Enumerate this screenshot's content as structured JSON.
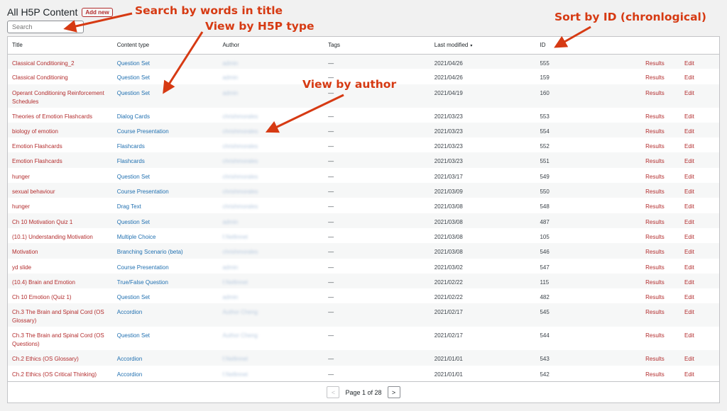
{
  "header": {
    "title": "All H5P Content",
    "add_new": "Add new"
  },
  "search": {
    "placeholder": "Search"
  },
  "columns": [
    "Title",
    "Content type",
    "Author",
    "Tags",
    "Last modified",
    "ID"
  ],
  "sort_indicator": "▾",
  "rows": [
    {
      "title": "Classical Conditioning_2",
      "type": "Question Set",
      "author": "admin",
      "tags": "—",
      "modified": "2021/04/26",
      "id": "555",
      "results": "Results",
      "edit": "Edit"
    },
    {
      "title": "Classical Conditioning",
      "type": "Question Set",
      "author": "admin",
      "tags": "—",
      "modified": "2021/04/26",
      "id": "159",
      "results": "Results",
      "edit": "Edit"
    },
    {
      "title": "Operant Conditioning Reinforcement Schedules",
      "type": "Question Set",
      "author": "admin",
      "tags": "—",
      "modified": "2021/04/19",
      "id": "160",
      "results": "Results",
      "edit": "Edit",
      "tall": true
    },
    {
      "title": "Theories of Emotion Flashcards",
      "type": "Dialog Cards",
      "author": "chrishmorales",
      "tags": "—",
      "modified": "2021/03/23",
      "id": "553",
      "results": "Results",
      "edit": "Edit"
    },
    {
      "title": "biology of emotion",
      "type": "Course Presentation",
      "author": "chrishmorales",
      "tags": "—",
      "modified": "2021/03/23",
      "id": "554",
      "results": "Results",
      "edit": "Edit"
    },
    {
      "title": "Emotion Flashcards",
      "type": "Flashcards",
      "author": "chrishmorales",
      "tags": "—",
      "modified": "2021/03/23",
      "id": "552",
      "results": "Results",
      "edit": "Edit"
    },
    {
      "title": "Emotion Flashcards",
      "type": "Flashcards",
      "author": "chrishmorales",
      "tags": "—",
      "modified": "2021/03/23",
      "id": "551",
      "results": "Results",
      "edit": "Edit"
    },
    {
      "title": "hunger",
      "type": "Question Set",
      "author": "chrishmorales",
      "tags": "—",
      "modified": "2021/03/17",
      "id": "549",
      "results": "Results",
      "edit": "Edit"
    },
    {
      "title": "sexual behaviour",
      "type": "Course Presentation",
      "author": "chrishmorales",
      "tags": "—",
      "modified": "2021/03/09",
      "id": "550",
      "results": "Results",
      "edit": "Edit"
    },
    {
      "title": "hunger",
      "type": "Drag Text",
      "author": "chrishmorales",
      "tags": "—",
      "modified": "2021/03/08",
      "id": "548",
      "results": "Results",
      "edit": "Edit"
    },
    {
      "title": "Ch 10 Motivation Quiz 1",
      "type": "Question Set",
      "author": "admin",
      "tags": "—",
      "modified": "2021/03/08",
      "id": "487",
      "results": "Results",
      "edit": "Edit"
    },
    {
      "title": "(10.1) Understanding Motivation",
      "type": "Multiple Choice",
      "author": "f.Nellinnet",
      "tags": "—",
      "modified": "2021/03/08",
      "id": "105",
      "results": "Results",
      "edit": "Edit"
    },
    {
      "title": "Motivation",
      "type": "Branching Scenario (beta)",
      "author": "chrishmorales",
      "tags": "—",
      "modified": "2021/03/08",
      "id": "546",
      "results": "Results",
      "edit": "Edit"
    },
    {
      "title": "yd slide",
      "type": "Course Presentation",
      "author": "admin",
      "tags": "—",
      "modified": "2021/03/02",
      "id": "547",
      "results": "Results",
      "edit": "Edit"
    },
    {
      "title": "(10.4) Brain and Emotion",
      "type": "True/False Question",
      "author": "f.Nellinnet",
      "tags": "—",
      "modified": "2021/02/22",
      "id": "115",
      "results": "Results",
      "edit": "Edit"
    },
    {
      "title": "Ch 10 Emotion (Quiz 1)",
      "type": "Question Set",
      "author": "admin",
      "tags": "—",
      "modified": "2021/02/22",
      "id": "482",
      "results": "Results",
      "edit": "Edit"
    },
    {
      "title": "Ch.3 The Brain and Spinal Cord (OS Glossary)",
      "type": "Accordion",
      "author": "Author Cheng",
      "tags": "—",
      "modified": "2021/02/17",
      "id": "545",
      "results": "Results",
      "edit": "Edit",
      "tall": true
    },
    {
      "title": "Ch.3 The Brain and Spinal Cord (OS Questions)",
      "type": "Question Set",
      "author": "Author Cheng",
      "tags": "—",
      "modified": "2021/02/17",
      "id": "544",
      "results": "Results",
      "edit": "Edit",
      "tall": true
    },
    {
      "title": "Ch.2 Ethics (OS Glossary)",
      "type": "Accordion",
      "author": "f.Nellinnet",
      "tags": "—",
      "modified": "2021/01/01",
      "id": "543",
      "results": "Results",
      "edit": "Edit"
    },
    {
      "title": "Ch.2 Ethics (OS Critical Thinking)",
      "type": "Accordion",
      "author": "f.Nellinnet",
      "tags": "—",
      "modified": "2021/01/01",
      "id": "542",
      "results": "Results",
      "edit": "Edit"
    }
  ],
  "pagination": {
    "prev": "<",
    "label": "Page 1 of 28",
    "next": ">"
  },
  "annotations": {
    "search": "Search by words in title",
    "type": "View by H5P type",
    "author": "View by author",
    "sort": "Sort by ID (chronlogical)"
  },
  "colors": {
    "annotation": "#d63a13",
    "link_red": "#b32d2e",
    "link_blue": "#2271b1"
  }
}
